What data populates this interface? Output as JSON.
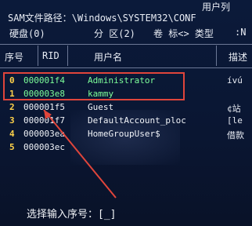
{
  "title_right": "用户列",
  "path_line": "SAM文件路径：\\Windows\\SYSTEM32\\CONF",
  "info_line": {
    "disk_label": "硬盘(0)",
    "part_label": "分 区(2)",
    "vol_label": "卷 标<> 类型",
    "type_value": ":N"
  },
  "columns": {
    "index": "序号",
    "rid": "RID",
    "user": "用户名",
    "desc": "描述"
  },
  "rows": [
    {
      "index": "0",
      "rid": "000001f4",
      "name": "Administrator",
      "desc": "ívú",
      "highlight": true
    },
    {
      "index": "1",
      "rid": "000003e8",
      "name": "kammy",
      "desc": "",
      "highlight": true
    },
    {
      "index": "2",
      "rid": "000001f5",
      "name": "Guest",
      "desc": "¢站",
      "highlight": false
    },
    {
      "index": "3",
      "rid": "000001f7",
      "name": "DefaultAccount_ploc",
      "desc": "[le",
      "highlight": false
    },
    {
      "index": "4",
      "rid": "000003ea",
      "name": "HomeGroupUser$",
      "desc": "借款",
      "highlight": false
    },
    {
      "index": "5",
      "rid": "000003ec",
      "name": "",
      "desc": "",
      "highlight": false
    }
  ],
  "prompt": "选择输入序号：[_]",
  "colors": {
    "background": "#0b1a3a",
    "index_yellow": "#ffd24a",
    "highlight_green": "#7dff9a",
    "annotation_red": "#e0453b"
  }
}
